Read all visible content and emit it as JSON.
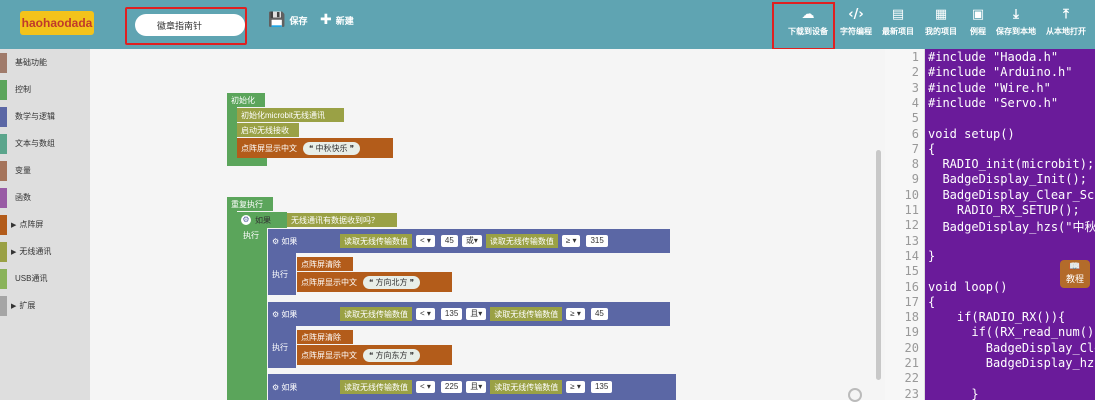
{
  "header": {
    "logo": "haohaodada",
    "project_name": "徽章指南针",
    "save": "保存",
    "new": "新建",
    "download": "下载到设备",
    "char_code": "字符编程",
    "recent": "最新项目",
    "my_projects": "我的项目",
    "examples": "例程",
    "save_local": "保存到本地",
    "open_local": "从本地打开"
  },
  "sidebar": {
    "categories": [
      {
        "label": "基础功能",
        "color": "#a07b6b"
      },
      {
        "label": "控制",
        "color": "#5ba55b"
      },
      {
        "label": "数学与逻辑",
        "color": "#5b67a5"
      },
      {
        "label": "文本与数组",
        "color": "#5ba58c"
      },
      {
        "label": "变量",
        "color": "#a5745b"
      },
      {
        "label": "函数",
        "color": "#995ba5"
      },
      {
        "label": "点阵屏",
        "color": "#b35c1a",
        "arrow": "▶"
      },
      {
        "label": "无线通讯",
        "color": "#9aa145",
        "arrow": "▶"
      },
      {
        "label": "USB通讯",
        "color": "#8ab35a"
      },
      {
        "label": "扩展",
        "color": "#a5a5a5",
        "arrow": "▶"
      }
    ]
  },
  "blocks": {
    "init": "初始化",
    "init_radio": "初始化microbit无线通讯",
    "start_rx": "启动无线接收",
    "show_text": "点阵屏显示中文",
    "text1": "中秋快乐",
    "loop": "重复执行",
    "if": "如果",
    "has_data": "无线通讯有数据收到吗？",
    "do": "执行",
    "read_val": "读取无线传输数值",
    "lt": "<",
    "gte": "≥",
    "or": "或",
    "and": "且",
    "v45": "45",
    "v315": "315",
    "v135": "135",
    "v225": "225",
    "clear": "点阵屏清除",
    "text2": "方向北方",
    "text3": "方向东方"
  },
  "code": {
    "lines": [
      "#include \"Haoda.h\"",
      "#include \"Arduino.h\"",
      "#include \"Wire.h\"",
      "#include \"Servo.h\"",
      "",
      "void setup()",
      "{",
      "  RADIO_init(microbit);",
      "  BadgeDisplay_Init();",
      "  BadgeDisplay_Clear_Scr",
      "    RADIO_RX_SETUP();",
      "  BadgeDisplay_hzs(\"中秋",
      "",
      "}",
      "",
      "void loop()",
      "{",
      "    if(RADIO_RX()){",
      "      if((RX_read_num()",
      "        BadgeDisplay_Cle",
      "        BadgeDisplay_hzs",
      "",
      "      }"
    ],
    "numbers": [
      "1",
      "2",
      "3",
      "4",
      "5",
      "6",
      "7",
      "8",
      "9",
      "10",
      "11",
      "12",
      "13",
      "14",
      "15",
      "16",
      "17",
      "18",
      "19",
      "20",
      "21",
      "22",
      "23"
    ]
  },
  "tutorial": "教程"
}
